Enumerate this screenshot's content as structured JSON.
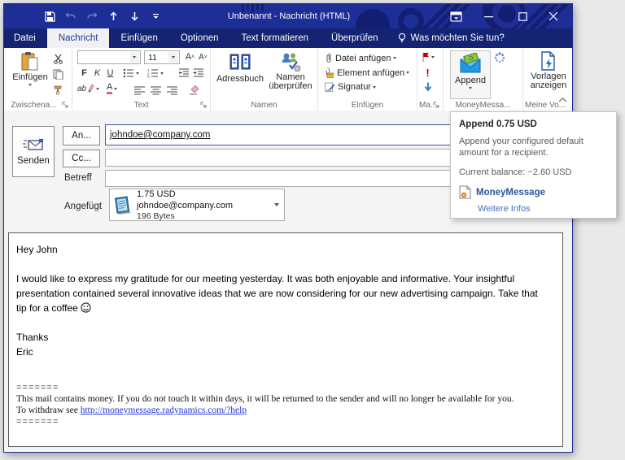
{
  "window": {
    "title": "Unbenannt - Nachricht (HTML)"
  },
  "tabs": {
    "file": "Datei",
    "message": "Nachricht",
    "insert": "Einfügen",
    "options": "Optionen",
    "format": "Text formatieren",
    "review": "Überprüfen",
    "tellme": "Was möchten Sie tun?"
  },
  "ribbon": {
    "clipboard": {
      "paste": "Einfügen",
      "group": "Zwischena..."
    },
    "text": {
      "size": "11",
      "bold": "F",
      "italic": "K",
      "underline": "U",
      "highlight": "ab",
      "fontcolor": "A",
      "group": "Text"
    },
    "names": {
      "address_book": "Adressbuch",
      "check_names": "Namen überprüfen",
      "group": "Namen"
    },
    "include": {
      "attach_file": "Datei anfügen",
      "attach_item": "Element anfügen",
      "signature": "Signatur",
      "group": "Einfügen"
    },
    "tags": {
      "high": "!",
      "group": "Ma..."
    },
    "moneymessage": {
      "append": "Append",
      "group": "MoneyMessa..."
    },
    "templates": {
      "line1": "Vorlagen",
      "line2": "anzeigen",
      "group": "Meine Vo..."
    }
  },
  "compose": {
    "send": "Senden",
    "to_button": "An...",
    "cc_button": "Cc...",
    "subject_label": "Betreff",
    "to_value": "johndoe@company.com",
    "attached_label": "Angefügt",
    "attachment": {
      "title": "1.75 USD johndoe@company.com",
      "size": "196 Bytes"
    }
  },
  "tooltip": {
    "title": "Append 0.75 USD",
    "desc": "Append your configured default amount for a recipient.",
    "balance": "Current balance: ~2.60 USD",
    "brand": "MoneyMessage",
    "more": "Weitere Infos"
  },
  "body": {
    "greeting": "Hey John",
    "paragraph": "I would like to express my gratitude for our meeting yesterday. It was both enjoyable and informative. Your insightful presentation contained several innovative ideas that we are now considering for our new advertising campaign. Take that tip for a coffee",
    "thanks": "Thanks",
    "signature_name": "Eric",
    "divider": "=======",
    "notice": "This mail contains money. If you do not touch it within days, it will be returned to the sender and will no longer be available for you.",
    "withdraw_prefix": "To withdraw see",
    "withdraw_link": "http://moneymessage.radynamics.com/?help"
  },
  "icons": {
    "smiley": "smile-emoji",
    "append": "envelope-with-money",
    "spinner": "loading-spinner",
    "templates": "document-lightning",
    "brand": "document-gear"
  },
  "colors": {
    "titlebar": "#1d2e97",
    "tabbar": "#142372",
    "brand_blue": "#2b579a",
    "link_blue": "#4472c4",
    "footer_link": "#2038d0",
    "flag_red": "#c00000",
    "money_green": "#70ad47",
    "envelope_blue": "#1e9be2"
  }
}
